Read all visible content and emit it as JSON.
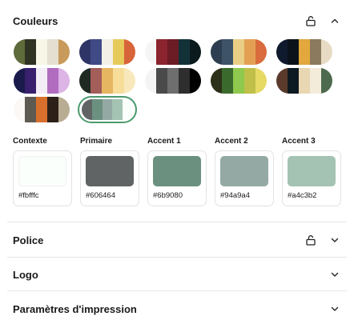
{
  "colors_section": {
    "title": "Couleurs",
    "palettes": [
      [
        "#5e6b3a",
        "#2f3324",
        "#f8f6e6",
        "#e4dfd0",
        "#c89a5b"
      ],
      [
        "#2e3566",
        "#3f4a86",
        "#f2f0e7",
        "#e6ca5c",
        "#d8643a"
      ],
      [
        "#f6f6f6",
        "#8c2430",
        "#6b1c24",
        "#123238",
        "#0b1a1d"
      ],
      [
        "#2c3e50",
        "#3e5268",
        "#e8cf85",
        "#e3a055",
        "#da6b3c"
      ],
      [
        "#0f1a2e",
        "#0c1219",
        "#e2a83c",
        "#8b7a5e",
        "#e8dbc6"
      ],
      [
        "#1a1a4b",
        "#38206e",
        "#f3eef6",
        "#b16cc0",
        "#dcb4e6"
      ],
      [
        "#1f2a23",
        "#a35e5a",
        "#e6b661",
        "#f6dd9a",
        "#f8e8bc"
      ],
      [
        "#f4f4f4",
        "#4a4a4a",
        "#6e6e6e",
        "#2e2e2e",
        "#000000"
      ],
      [
        "#2d3019",
        "#3b6b2c",
        "#8fc94e",
        "#bfc049",
        "#e6da65"
      ],
      [
        "#5a3a2b",
        "#0e1a22",
        "#e9d6b2",
        "#f3ecdb",
        "#4e6a4e"
      ],
      [
        "#fbf8f6",
        "#5e5a52",
        "#d86f2d",
        "#2c2018",
        "#b8ad93"
      ],
      [
        "#606464",
        "#6b9080",
        "#94a9a4",
        "#a4c3b2",
        "#fbfffc"
      ]
    ],
    "selected_index": 11,
    "roles": [
      {
        "label": "Contexte",
        "hex": "#fbfffc"
      },
      {
        "label": "Primaire",
        "hex": "#606464"
      },
      {
        "label": "Accent 1",
        "hex": "#6b9080"
      },
      {
        "label": "Accent 2",
        "hex": "#94a9a4"
      },
      {
        "label": "Accent 3",
        "hex": "#a4c3b2"
      }
    ]
  },
  "font_section": {
    "title": "Police"
  },
  "logo_section": {
    "title": "Logo"
  },
  "print_section": {
    "title": "Paramètres d'impression"
  }
}
